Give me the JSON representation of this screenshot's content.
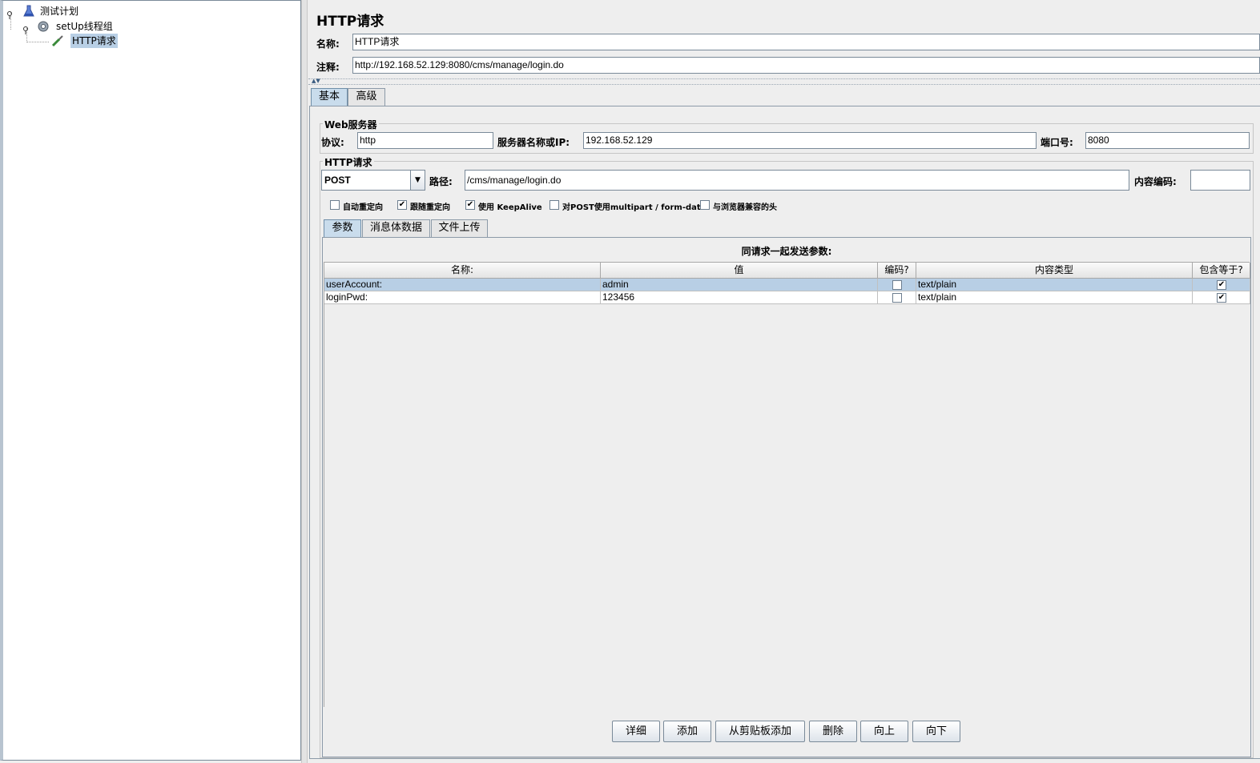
{
  "tree": {
    "items": [
      {
        "label": "测试计划",
        "icon": "flask-icon"
      },
      {
        "label": "setUp线程组",
        "icon": "gear-icon"
      },
      {
        "label": "HTTP请求",
        "icon": "pipette-icon",
        "selected": true
      }
    ]
  },
  "panel": {
    "title": "HTTP请求",
    "name_label": "名称:",
    "name_value": "HTTP请求",
    "comment_label": "注释:",
    "comment_value": "http://192.168.52.129:8080/cms/manage/login.do"
  },
  "tabs": {
    "basic": "基本",
    "advanced": "高级"
  },
  "web_server": {
    "group_title": "Web服务器",
    "protocol_label": "协议:",
    "protocol_value": "http",
    "server_label": "服务器名称或IP:",
    "server_value": "192.168.52.129",
    "port_label": "端口号:",
    "port_value": "8080"
  },
  "http_request": {
    "group_title": "HTTP请求",
    "method": "POST",
    "path_label": "路径:",
    "path_value": "/cms/manage/login.do",
    "encoding_label": "内容编码:",
    "encoding_value": "",
    "options": [
      {
        "label": "自动重定向",
        "checked": false
      },
      {
        "label": "跟随重定向",
        "checked": true
      },
      {
        "label": "使用 KeepAlive",
        "checked": true
      },
      {
        "label": "对POST使用multipart / form-data",
        "checked": false
      },
      {
        "label": "与浏览器兼容的头",
        "checked": false
      }
    ]
  },
  "subtabs": {
    "params": "参数",
    "body": "消息体数据",
    "files": "文件上传"
  },
  "params_table": {
    "caption": "同请求一起发送参数:",
    "columns": [
      "名称:",
      "值",
      "编码?",
      "内容类型",
      "包含等于?"
    ],
    "rows": [
      {
        "name": "userAccount:",
        "value": "admin",
        "encode": false,
        "content_type": "text/plain",
        "include_equals": true
      },
      {
        "name": "loginPwd:",
        "value": "123456",
        "encode": false,
        "content_type": "text/plain",
        "include_equals": true
      }
    ]
  },
  "buttons": {
    "detail": "详细",
    "add": "添加",
    "add_clipboard": "从剪贴板添加",
    "delete": "删除",
    "up": "向上",
    "down": "向下"
  },
  "colors": {
    "selection": "#b8cfe5",
    "tab_active": "#c9dcec",
    "panel_bg": "#eeeeee"
  }
}
